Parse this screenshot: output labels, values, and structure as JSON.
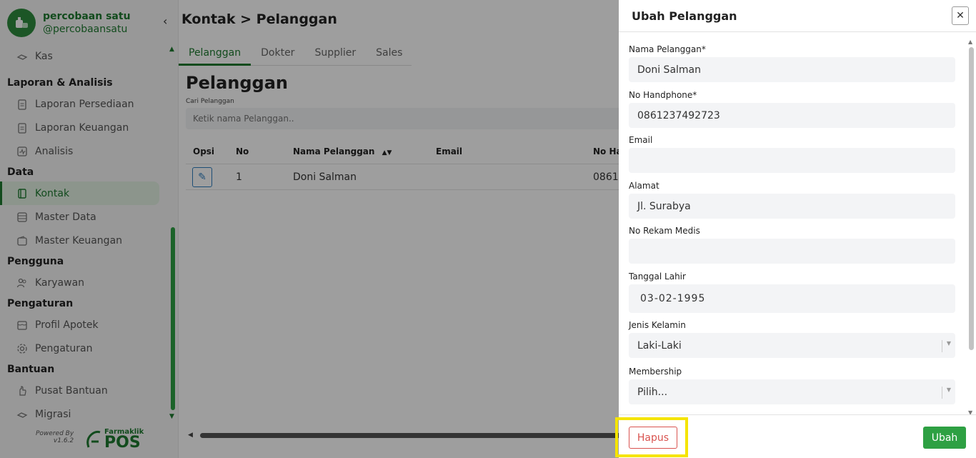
{
  "brand": {
    "name": "percobaan satu",
    "handle": "@percobaansatu"
  },
  "nav": {
    "items_top": [
      {
        "label": "Kas"
      }
    ],
    "sections": [
      {
        "title": "Laporan & Analisis",
        "items": [
          {
            "label": "Laporan Persediaan"
          },
          {
            "label": "Laporan Keuangan"
          },
          {
            "label": "Analisis"
          }
        ]
      },
      {
        "title": "Data",
        "items": [
          {
            "label": "Kontak"
          },
          {
            "label": "Master Data"
          },
          {
            "label": "Master Keuangan"
          }
        ]
      },
      {
        "title": "Pengguna",
        "items": [
          {
            "label": "Karyawan"
          }
        ]
      },
      {
        "title": "Pengaturan",
        "items": [
          {
            "label": "Profil Apotek"
          },
          {
            "label": "Pengaturan"
          }
        ]
      },
      {
        "title": "Bantuan",
        "items": [
          {
            "label": "Pusat Bantuan"
          },
          {
            "label": "Migrasi"
          }
        ]
      }
    ]
  },
  "footer": {
    "powered_by": "Powered By",
    "version": "v1.6.2",
    "logo_small": "Farmaklik",
    "logo_big": "POS"
  },
  "page": {
    "breadcrumb": "Kontak > Pelanggan",
    "tabs": [
      {
        "label": "Pelanggan"
      },
      {
        "label": "Dokter"
      },
      {
        "label": "Supplier"
      },
      {
        "label": "Sales"
      }
    ],
    "title": "Pelanggan",
    "search_label": "Cari Pelanggan",
    "search_placeholder": "Ketik nama Pelanggan..",
    "table": {
      "headers": {
        "opsi": "Opsi",
        "no": "No",
        "nama": "Nama Pelanggan",
        "email": "Email",
        "hp": "No Ha"
      },
      "rows": [
        {
          "no": "1",
          "nama": "Doni Salman",
          "email": "",
          "hp": "0861"
        }
      ]
    }
  },
  "modal": {
    "title": "Ubah Pelanggan",
    "fields": {
      "nama": {
        "label": "Nama Pelanggan*",
        "value": "Doni Salman"
      },
      "hp": {
        "label": "No Handphone*",
        "value": "0861237492723"
      },
      "email": {
        "label": "Email",
        "value": ""
      },
      "alamat": {
        "label": "Alamat",
        "value": "Jl. Surabya"
      },
      "rekam": {
        "label": "No Rekam Medis",
        "value": ""
      },
      "lahir": {
        "label": "Tanggal Lahir",
        "value": "03-02-1995"
      },
      "kelamin": {
        "label": "Jenis Kelamin",
        "value": "Laki-Laki"
      },
      "membership": {
        "label": "Membership",
        "value": "Pilih..."
      }
    },
    "delete_label": "Hapus",
    "update_label": "Ubah"
  },
  "colors": {
    "accent": "#1e7a30",
    "button_green": "#2ea043",
    "danger": "#d9534f",
    "highlight": "#f5e400"
  }
}
